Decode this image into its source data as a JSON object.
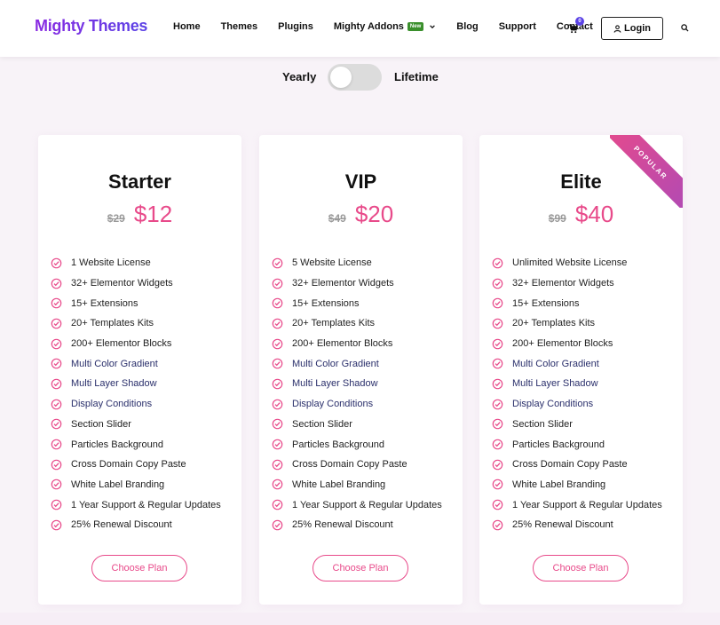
{
  "header": {
    "logo": "Mighty Themes",
    "nav": [
      "Home",
      "Themes",
      "Plugins",
      "Mighty Addons",
      "Blog",
      "Support",
      "Contact"
    ],
    "new_badge": "New",
    "cart_count": "0",
    "login": "Login"
  },
  "billing": {
    "yearly": "Yearly",
    "lifetime": "Lifetime"
  },
  "plans": [
    {
      "name": "Starter",
      "old_price": "$29",
      "currency": "$",
      "price": "12",
      "features": [
        "1 Website License",
        "32+ Elementor Widgets",
        "15+ Extensions",
        "20+ Templates Kits",
        "200+ Elementor Blocks",
        "Multi Color Gradient",
        "Multi Layer Shadow",
        "Display Conditions",
        "Section Slider",
        "Particles Background",
        "Cross Domain Copy Paste",
        "White Label Branding",
        "1 Year Support & Regular Updates",
        "25% Renewal Discount"
      ],
      "cta": "Choose Plan"
    },
    {
      "name": "VIP",
      "old_price": "$49",
      "currency": "$",
      "price": "20",
      "features": [
        "5 Website License",
        "32+ Elementor Widgets",
        "15+ Extensions",
        "20+ Templates Kits",
        "200+ Elementor Blocks",
        "Multi Color Gradient",
        "Multi Layer Shadow",
        "Display Conditions",
        "Section Slider",
        "Particles Background",
        "Cross Domain Copy Paste",
        "White Label Branding",
        "1 Year Support & Regular Updates",
        "25% Renewal Discount"
      ],
      "cta": "Choose Plan"
    },
    {
      "name": "Elite",
      "old_price": "$99",
      "currency": "$",
      "price": "40",
      "ribbon": "POPULAR",
      "features": [
        "Unlimited Website License",
        "32+ Elementor Widgets",
        "15+ Extensions",
        "20+ Templates Kits",
        "200+ Elementor Blocks",
        "Multi Color Gradient",
        "Multi Layer Shadow",
        "Display Conditions",
        "Section Slider",
        "Particles Background",
        "Cross Domain Copy Paste",
        "White Label Branding",
        "1 Year Support & Regular Updates",
        "25% Renewal Discount"
      ],
      "cta": "Choose Plan"
    }
  ],
  "colors": {
    "accent": "#e84a8a",
    "brand": "#5b43e6",
    "feature_accent": "#2a2f6b"
  },
  "icons": [
    "cart-icon",
    "user-icon",
    "search-icon",
    "chevron-down-icon",
    "check-circle-icon"
  ]
}
